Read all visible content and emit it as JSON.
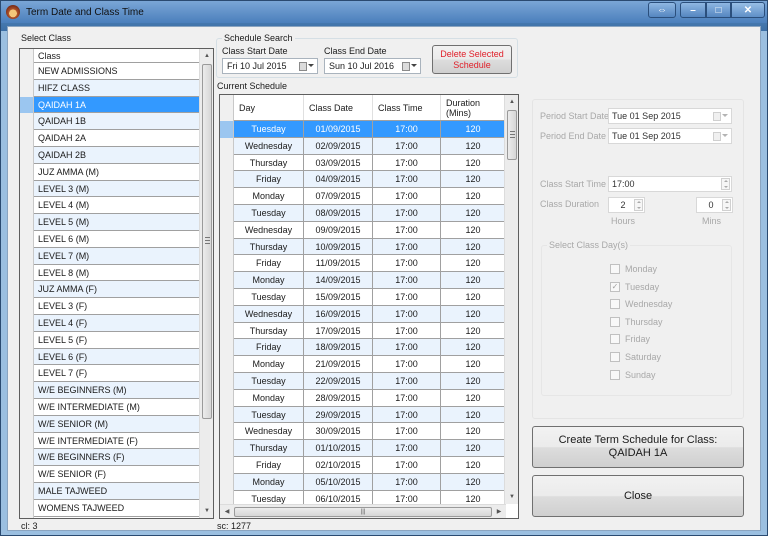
{
  "window": {
    "title": "Term Date and Class Time",
    "buttons": {
      "swap": "⇔",
      "minimize": "–",
      "maximize": "□",
      "close": "✕"
    }
  },
  "class_panel": {
    "label": "Select Class",
    "column_header": "Class",
    "selected_index": 2,
    "classes": [
      "NEW ADMISSIONS",
      "HIFZ CLASS",
      "QAIDAH 1A",
      "QAIDAH 1B",
      "QAIDAH 2A",
      "QAIDAH 2B",
      "JUZ AMMA (M)",
      "LEVEL 3 (M)",
      "LEVEL 4 (M)",
      "LEVEL 5 (M)",
      "LEVEL 6 (M)",
      "LEVEL 7 (M)",
      "LEVEL 8 (M)",
      "JUZ AMMA (F)",
      "LEVEL 3 (F)",
      "LEVEL 4 (F)",
      "LEVEL 5 (F)",
      "LEVEL 6 (F)",
      "LEVEL 7 (F)",
      "W/E BEGINNERS (M)",
      "W/E INTERMEDIATE (M)",
      "W/E SENIOR (M)",
      "W/E INTERMEDIATE (F)",
      "W/E BEGINNERS (F)",
      "W/E SENIOR (F)",
      "MALE TAJWEED",
      "WOMENS TAJWEED"
    ],
    "status": "cl: 3"
  },
  "schedule_search": {
    "title": "Schedule Search",
    "start_label": "Class Start Date",
    "start_value": "Fri  10  Jul  2015",
    "end_label": "Class End Date",
    "end_value": "Sun  10  Jul  2016",
    "delete_button": "Delete Selected Schedule",
    "delete_color": "#e0202a"
  },
  "schedule": {
    "label": "Current Schedule",
    "columns": [
      "Day",
      "Class Date",
      "Class Time",
      "Duration (Mins)"
    ],
    "selected_index": 0,
    "rows": [
      [
        "Tuesday",
        "01/09/2015",
        "17:00",
        "120"
      ],
      [
        "Wednesday",
        "02/09/2015",
        "17:00",
        "120"
      ],
      [
        "Thursday",
        "03/09/2015",
        "17:00",
        "120"
      ],
      [
        "Friday",
        "04/09/2015",
        "17:00",
        "120"
      ],
      [
        "Monday",
        "07/09/2015",
        "17:00",
        "120"
      ],
      [
        "Tuesday",
        "08/09/2015",
        "17:00",
        "120"
      ],
      [
        "Wednesday",
        "09/09/2015",
        "17:00",
        "120"
      ],
      [
        "Thursday",
        "10/09/2015",
        "17:00",
        "120"
      ],
      [
        "Friday",
        "11/09/2015",
        "17:00",
        "120"
      ],
      [
        "Monday",
        "14/09/2015",
        "17:00",
        "120"
      ],
      [
        "Tuesday",
        "15/09/2015",
        "17:00",
        "120"
      ],
      [
        "Wednesday",
        "16/09/2015",
        "17:00",
        "120"
      ],
      [
        "Thursday",
        "17/09/2015",
        "17:00",
        "120"
      ],
      [
        "Friday",
        "18/09/2015",
        "17:00",
        "120"
      ],
      [
        "Monday",
        "21/09/2015",
        "17:00",
        "120"
      ],
      [
        "Tuesday",
        "22/09/2015",
        "17:00",
        "120"
      ],
      [
        "Monday",
        "28/09/2015",
        "17:00",
        "120"
      ],
      [
        "Tuesday",
        "29/09/2015",
        "17:00",
        "120"
      ],
      [
        "Wednesday",
        "30/09/2015",
        "17:00",
        "120"
      ],
      [
        "Thursday",
        "01/10/2015",
        "17:00",
        "120"
      ],
      [
        "Friday",
        "02/10/2015",
        "17:00",
        "120"
      ],
      [
        "Monday",
        "05/10/2015",
        "17:00",
        "120"
      ],
      [
        "Tuesday",
        "06/10/2015",
        "17:00",
        "120"
      ]
    ],
    "status": "sc: 1277"
  },
  "settings": {
    "period_start_label": "Period Start Date",
    "period_start_value": "Tue  01 Sep  2015",
    "period_end_label": "Period End Date",
    "period_end_value": "Tue  01 Sep  2015",
    "class_start_label": "Class Start Time",
    "class_start_value": "17:00",
    "duration_label": "Class Duration",
    "hours_value": "2",
    "hours_label": "Hours",
    "mins_value": "0",
    "mins_label": "Mins",
    "days_group_label": "Select Class Day(s)",
    "days": [
      {
        "label": "Monday",
        "checked": false
      },
      {
        "label": "Tuesday",
        "checked": true
      },
      {
        "label": "Wednesday",
        "checked": false
      },
      {
        "label": "Thursday",
        "checked": false
      },
      {
        "label": "Friday",
        "checked": false
      },
      {
        "label": "Saturday",
        "checked": false
      },
      {
        "label": "Sunday",
        "checked": false
      }
    ]
  },
  "actions": {
    "create_button_line1": "Create Term Schedule for Class:",
    "create_button_line2": "QAIDAH 1A",
    "close_button": "Close"
  }
}
